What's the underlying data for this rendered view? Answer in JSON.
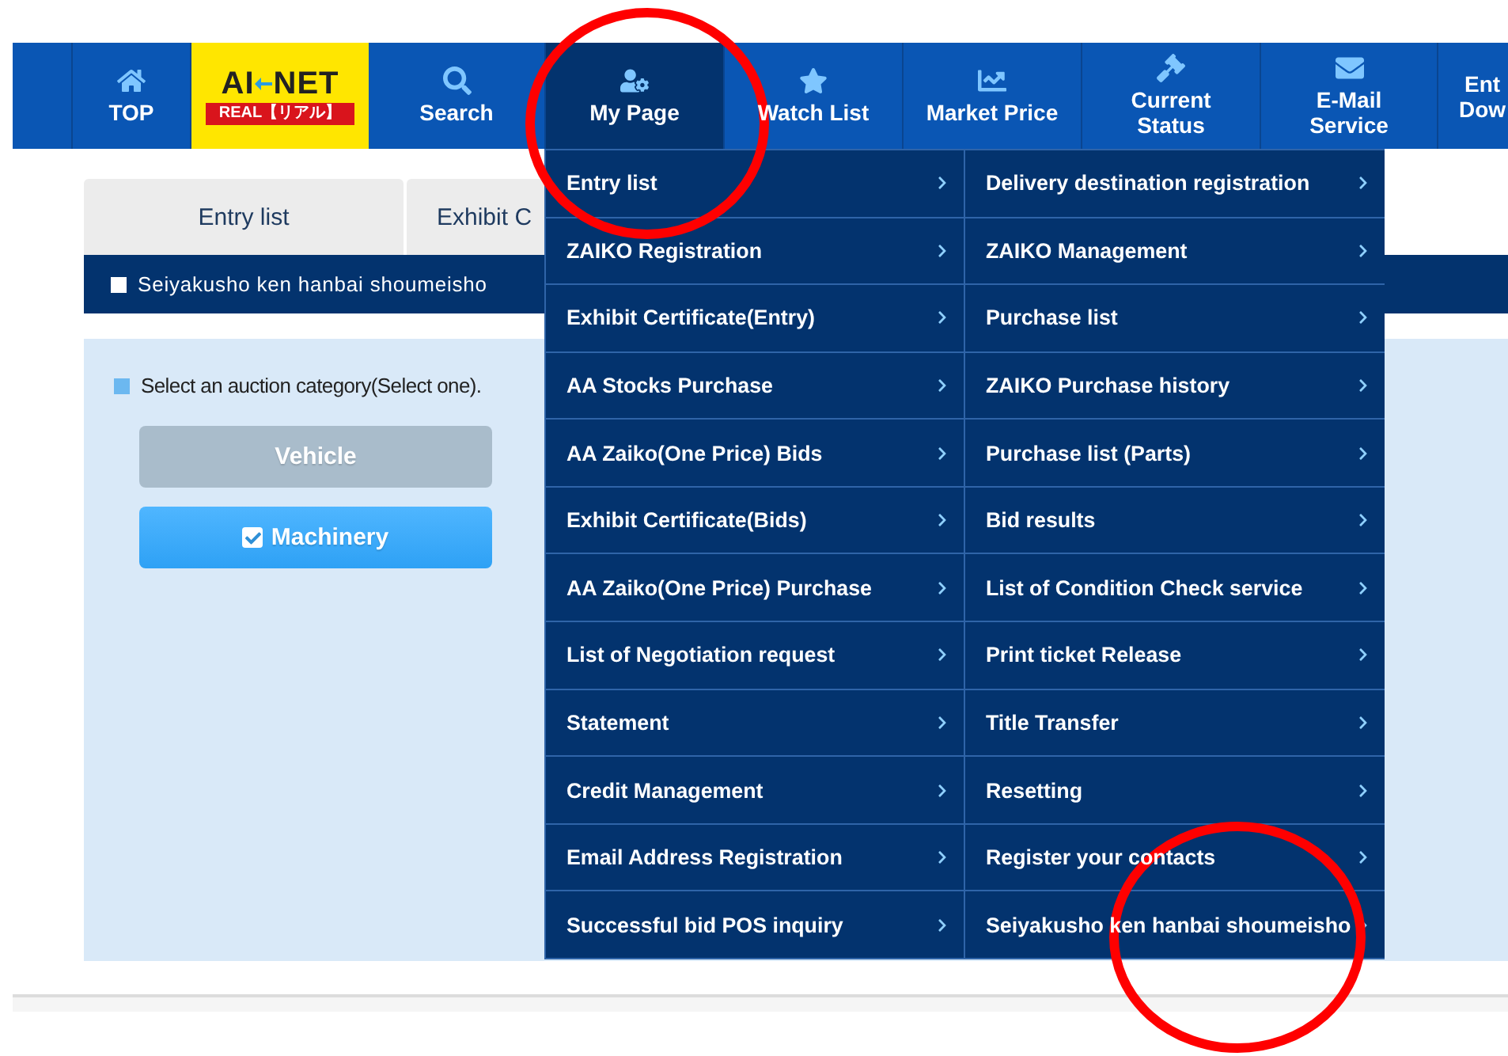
{
  "nav": {
    "items": [
      {
        "kind": "link",
        "lines": [
          "TOP"
        ],
        "selected": false
      },
      {
        "kind": "logo",
        "title_left": "AI",
        "title_right": "NET",
        "subtitle": "REAL【リアル】"
      },
      {
        "kind": "link",
        "lines": [
          "Search"
        ],
        "selected": false
      },
      {
        "kind": "link",
        "lines": [
          "My Page"
        ],
        "selected": true
      },
      {
        "kind": "link",
        "lines": [
          "Watch List"
        ],
        "selected": false
      },
      {
        "kind": "link",
        "lines": [
          "Market Price"
        ],
        "selected": false
      },
      {
        "kind": "link",
        "lines": [
          "Current",
          "Status"
        ],
        "selected": false
      },
      {
        "kind": "link",
        "lines": [
          "E-Mail",
          "Service"
        ],
        "selected": false
      },
      {
        "kind": "link",
        "lines": [
          "Ent",
          "Dow"
        ],
        "selected": false
      }
    ]
  },
  "tabs": [
    {
      "label": "Entry list"
    },
    {
      "label": "Exhibit C"
    }
  ],
  "section_bar": {
    "title": "Seiyakusho ken hanbai shoumeisho"
  },
  "panel": {
    "prompt": "Select an auction category(Select one).",
    "categories": [
      {
        "label": "Vehicle",
        "selected": false
      },
      {
        "label": "Machinery",
        "selected": true
      }
    ]
  },
  "dropdown": {
    "columns": [
      [
        "Entry list",
        "ZAIKO Registration",
        "Exhibit Certificate(Entry)",
        "AA Stocks Purchase",
        "AA Zaiko(One Price) Bids",
        "Exhibit Certificate(Bids)",
        "AA Zaiko(One Price) Purchase",
        "List of Negotiation request",
        "Statement",
        "Credit Management",
        "Email Address Registration",
        "Successful bid POS inquiry"
      ],
      [
        "Delivery destination registration",
        "ZAIKO Management",
        "Purchase list",
        "ZAIKO Purchase history",
        "Purchase list (Parts)",
        "Bid results",
        "List of Condition Check service",
        "Print ticket Release",
        "Title Transfer",
        "Resetting",
        "Register your contacts",
        "Seiyakusho ken hanbai shoumeisho"
      ]
    ]
  },
  "annotations": [
    {
      "kind": "circle"
    },
    {
      "kind": "circle"
    }
  ]
}
